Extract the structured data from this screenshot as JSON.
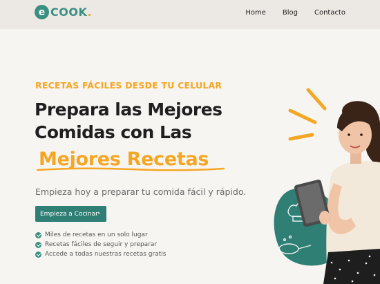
{
  "brand": {
    "logo_letter": "e",
    "logo_text": "COOK",
    "logo_dot": "."
  },
  "nav": {
    "items": [
      "Home",
      "Blog",
      "Contacto"
    ]
  },
  "hero": {
    "eyebrow": "RECETAS FÁCILES DESDE TU CELULAR",
    "title_line1": "Prepara las Mejores",
    "title_line2": "Comidas con Las",
    "title_accent": "Mejores Recetas",
    "subtitle": "Empieza hoy a preparar tu comida fácil y rápido.",
    "cta_label": "Empieza a Cocinar",
    "cta_icon": "chevron-right-icon",
    "features": [
      "Miles de recetas en un solo lugar",
      "Recetas fáciles de seguir y preparar",
      "Accede a todas nuestras recetas gratis"
    ]
  },
  "colors": {
    "teal": "#2f7f74",
    "orange": "#f5a623",
    "text_dark": "#1f1f1f",
    "background": "#f7f5f2",
    "header_bg": "#ece8e3"
  }
}
